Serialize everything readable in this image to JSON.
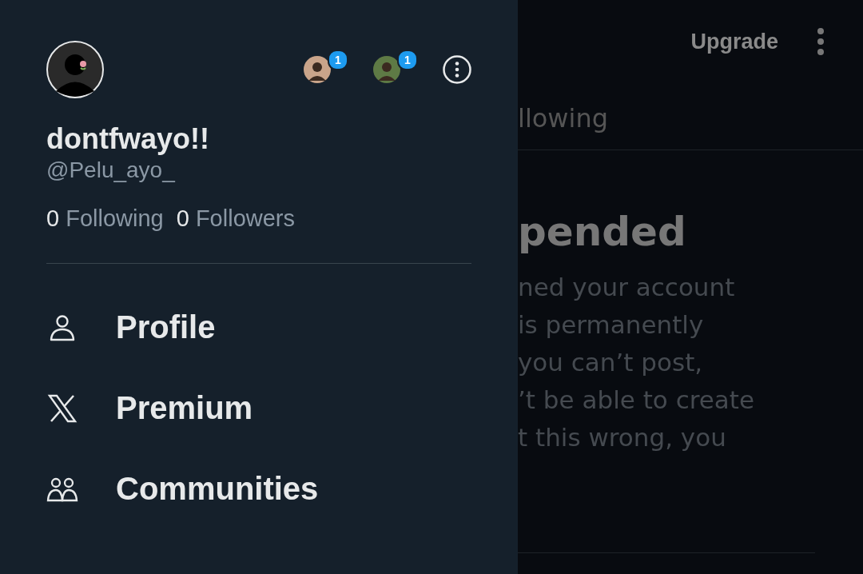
{
  "drawer": {
    "account": {
      "display_name": "dontfwayo!!",
      "handle": "@Pelu_ayo_",
      "following_count": "0",
      "following_label": "Following",
      "followers_count": "0",
      "followers_label": "Followers"
    },
    "other_accounts": [
      {
        "badge": "1",
        "color": "#c9a48a"
      },
      {
        "badge": "1",
        "color": "#5e7a45"
      }
    ],
    "menu": [
      {
        "kind": "profile",
        "label": "Profile"
      },
      {
        "kind": "premium",
        "label": "Premium"
      },
      {
        "kind": "communities",
        "label": "Communities"
      }
    ]
  },
  "background": {
    "upgrade_button": "Upgrade",
    "tab": "llowing",
    "heading": "pended",
    "body_lines": [
      "ned your account",
      "is permanently",
      "you can’t post,",
      "’t be able to create",
      "t this wrong, you"
    ]
  }
}
